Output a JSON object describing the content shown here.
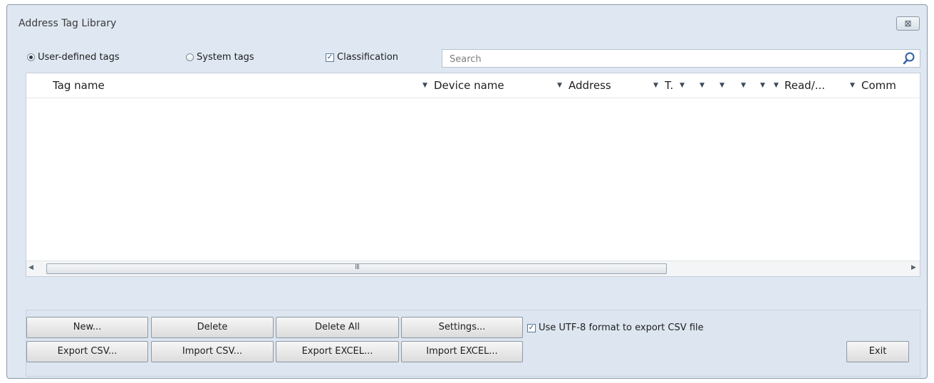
{
  "window": {
    "title": "Address Tag Library",
    "close_glyph": "⊠"
  },
  "filters": {
    "user_defined_label": "User-defined tags",
    "user_defined_selected": true,
    "system_label": "System tags",
    "system_selected": false,
    "classification_label": "Classification",
    "classification_checked": true
  },
  "search": {
    "placeholder": "Search",
    "value": "",
    "icon": "search-icon"
  },
  "table": {
    "columns": [
      "Tag name",
      "Device name",
      "Address",
      "T.",
      "",
      "",
      "",
      "",
      "Read/...",
      "Comm"
    ],
    "rows": [],
    "scroll_grip": "III"
  },
  "buttons": {
    "new": "New...",
    "delete": "Delete",
    "delete_all": "Delete All",
    "settings": "Settings...",
    "export_csv": "Export CSV...",
    "import_csv": "Import CSV...",
    "export_excel": "Export EXCEL...",
    "import_excel": "Import EXCEL...",
    "exit": "Exit"
  },
  "utf8": {
    "label": "Use UTF-8 format to export CSV file",
    "checked": true
  },
  "colors": {
    "window_bg": "#dfe8f2",
    "accent": "#2a4f86"
  }
}
